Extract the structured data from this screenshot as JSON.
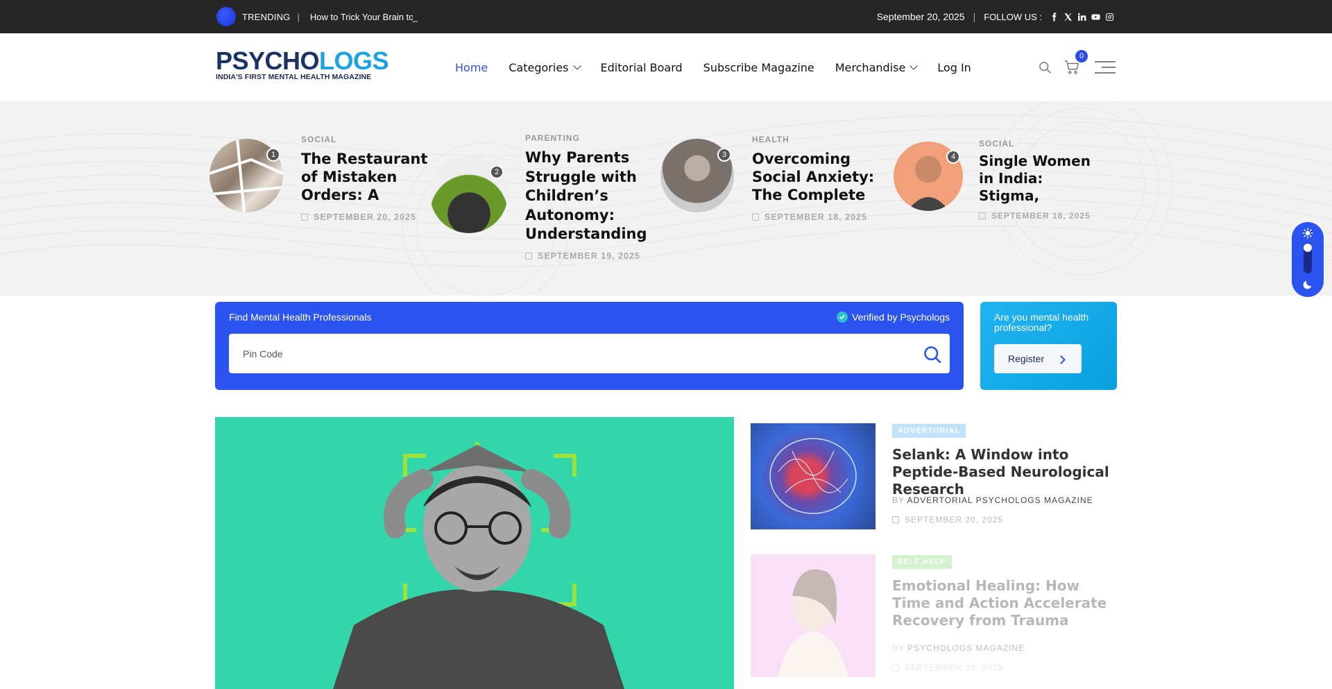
{
  "topbar": {
    "trending_label": "TRENDING",
    "separator": "|",
    "trending_text": "How to Trick Your Brain to Study",
    "cursor": "_",
    "date": "September 20, 2025",
    "follow_label": "FOLLOW US :",
    "social_icons": [
      "facebook-icon",
      "x-icon",
      "linkedin-icon",
      "youtube-icon",
      "instagram-icon"
    ]
  },
  "logo": {
    "part1": "PSYCHO",
    "part2": "LOGS",
    "tagline": "INDIA'S FIRST MENTAL HEALTH MAGAZINE"
  },
  "nav": {
    "items": [
      {
        "label": "Home",
        "active": true
      },
      {
        "label": "Categories",
        "dropdown": true
      },
      {
        "label": "Editorial Board"
      },
      {
        "label": "Subscribe Magazine"
      },
      {
        "label": "Merchandise",
        "dropdown": true
      },
      {
        "label": "Log In"
      }
    ],
    "cart_count": "0"
  },
  "featured": [
    {
      "rank": "1",
      "category": "SOCIAL",
      "title": "The Restaurant of Mistaken Orders: A Dementia-Friendly",
      "date": "SEPTEMBER 20, 2025"
    },
    {
      "rank": "2",
      "category": "PARENTING",
      "title": "Why Parents Struggle with Children’s Autonomy: Understanding",
      "date": "SEPTEMBER 19, 2025"
    },
    {
      "rank": "3",
      "category": "HEALTH",
      "title": "Overcoming Social Anxiety: The Complete Toolkit to",
      "date": "SEPTEMBER 18, 2025"
    },
    {
      "rank": "4",
      "category": "SOCIAL",
      "title": "Single Women in India: Stigma, Mental Health,",
      "date": "SEPTEMBER 18, 2025"
    }
  ],
  "finder": {
    "title": "Find Mental Health Professionals",
    "verified": "Verified by Psychologs",
    "placeholder": "Pin Code"
  },
  "register": {
    "question": "Are you mental health professional?",
    "button": "Register"
  },
  "side_articles": [
    {
      "badge": "ADVERTORIAL",
      "title": "Selank: A Window into Peptide-Based Neurological Research",
      "by": "BY",
      "author": "ADVERTORIAL PSYCHOLOGS MAGAZINE",
      "date": "SEPTEMBER 20, 2025"
    },
    {
      "badge": "SELF HELP",
      "title": "Emotional Healing: How Time and Action Accelerate Recovery from Trauma",
      "by": "BY",
      "author": "PSYCHOLOGS MAGAZINE",
      "date": "SEPTEMBER 20, 2025"
    }
  ],
  "colors": {
    "accent": "#2a53f0",
    "register_bg": "#14aaea",
    "hero_bg": "#33d6aa",
    "logo_dark": "#1b3266",
    "logo_light": "#1ba3e4",
    "badge_advertorial": "#bfe3fb",
    "badge_selfhelp": "#8ad87a"
  }
}
